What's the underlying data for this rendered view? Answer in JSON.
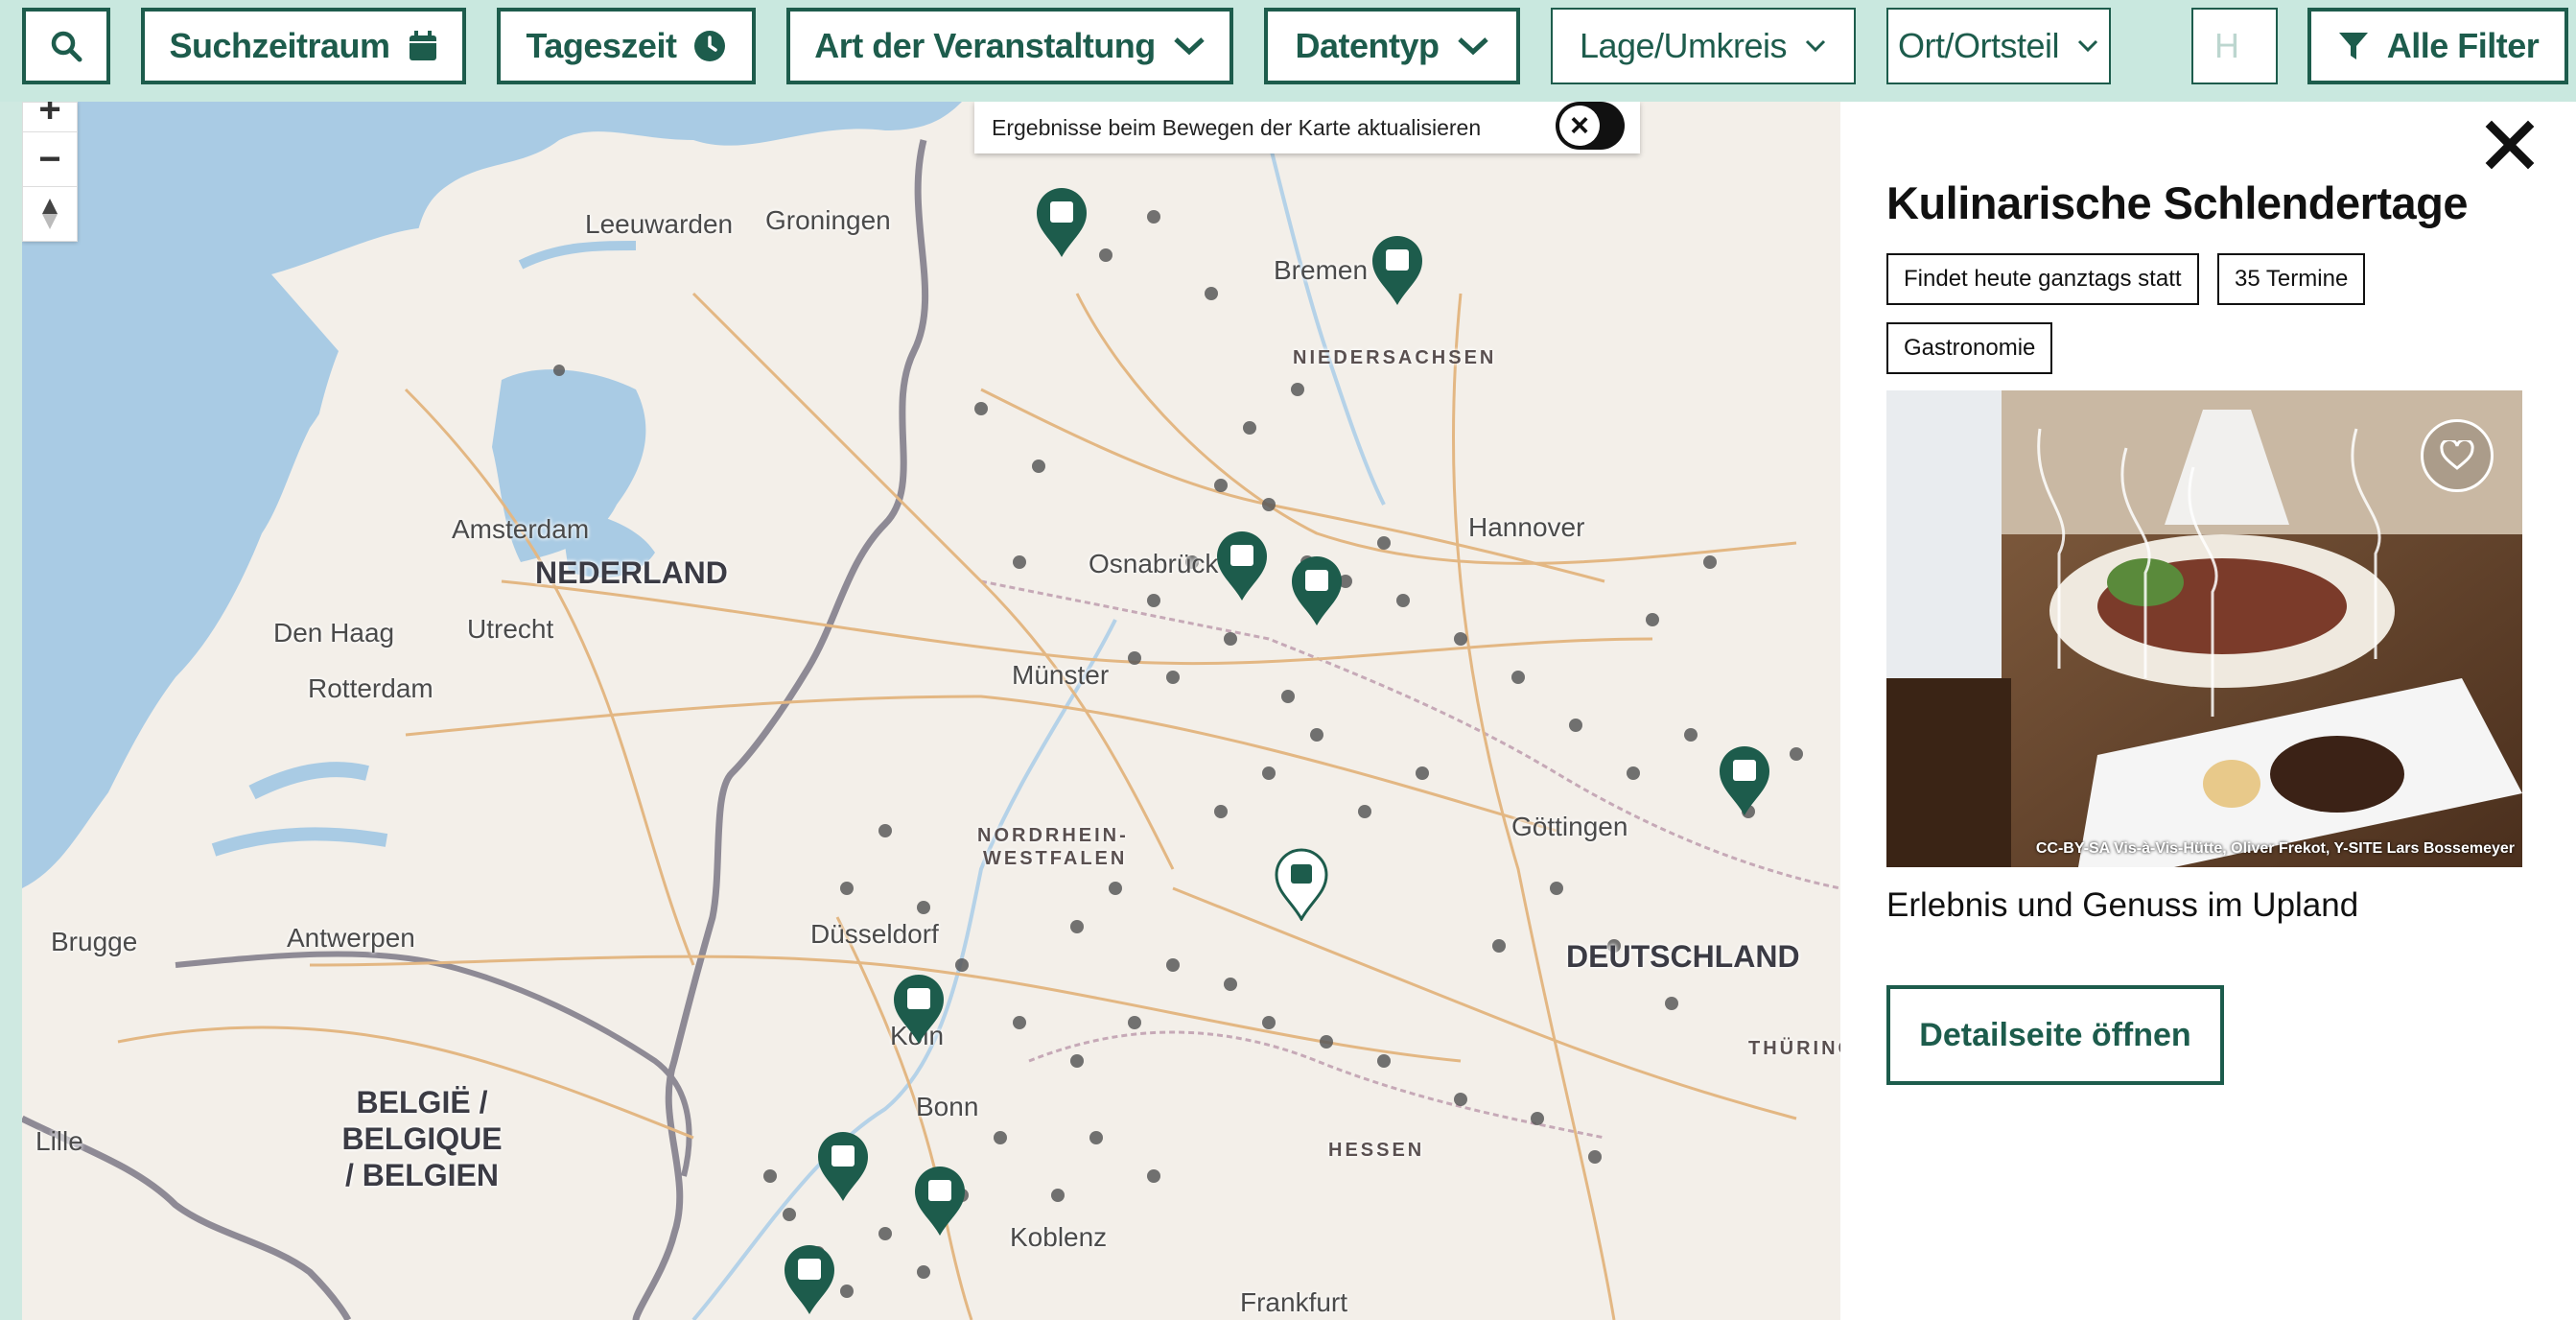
{
  "toolbar": {
    "filters": [
      {
        "label": "Suchzeitraum",
        "icon": "calendar-icon"
      },
      {
        "label": "Tageszeit",
        "icon": "clock-icon"
      },
      {
        "label": "Art der Veranstaltung",
        "icon": "chevron-down-icon"
      },
      {
        "label": "Datentyp",
        "icon": "chevron-down-icon"
      },
      {
        "label": "Lage/Umkreis",
        "icon": "chevron-down-icon"
      },
      {
        "label": "Ort/Ortsteil",
        "icon": "chevron-down-icon"
      },
      {
        "label": "H",
        "icon": ""
      }
    ],
    "all_filters_label": "Alle Filter",
    "accent_color": "#1d5c4c"
  },
  "map": {
    "toggle_label": "Ergebnisse beim Bewegen der Karte aktualisieren",
    "zoom_in": "+",
    "zoom_out": "−",
    "cities": [
      "Leeuwarden",
      "Groningen",
      "Bremen",
      "Amsterdam",
      "Den Haag",
      "Utrecht",
      "Rotterdam",
      "Osnabrück",
      "Hannover",
      "Münster",
      "Göttingen",
      "Brugge",
      "Antwerpen",
      "Düsseldorf",
      "Köln",
      "Bonn",
      "Koblenz",
      "Lille",
      "Frankfurt"
    ],
    "countries": [
      "NEDERLAND",
      "DEUTSCHLAND",
      "BELGIË /",
      "BELGIQUE",
      "/ BELGIEN"
    ],
    "regions": [
      "NIEDERSACHSEN",
      "NORDRHEIN-",
      "WESTFALEN",
      "HESSEN",
      "THÜRING"
    ],
    "pin_color": "#1d5c4c"
  },
  "panel": {
    "title": "Kulinarische Schlendertage",
    "tags": [
      "Findet heute ganztags statt",
      "35 Termine",
      "Gastronomie"
    ],
    "image_credit": "CC-BY-SA Vis-à-Vis-Hütte, Oliver Frekot, Y-SITE Lars Bossemeyer",
    "subtitle": "Erlebnis und Genuss im Upland",
    "detail_button": "Detailseite öffnen"
  }
}
